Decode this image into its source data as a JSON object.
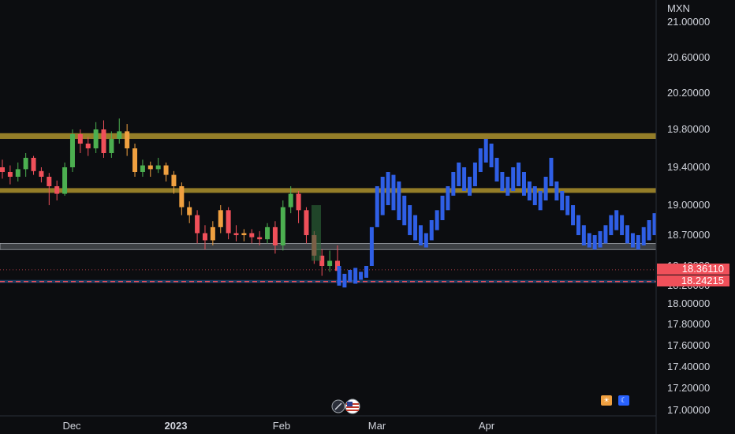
{
  "axis": {
    "currency": "MXN",
    "y_ticks": [
      "21.00000",
      "20.60000",
      "20.20000",
      "19.80000",
      "19.40000",
      "19.00000",
      "18.70000",
      "18.40000",
      "18.20000",
      "18.00000",
      "17.80000",
      "17.60000",
      "17.40000",
      "17.20000",
      "17.00000"
    ],
    "x_ticks": [
      "Dec",
      "2023",
      "Feb",
      "Mar",
      "Apr"
    ]
  },
  "price_tags": {
    "last_price": "18.36110",
    "dashed_level": "18.24215"
  },
  "colors": {
    "background": "#0c0d10",
    "up_candle": "#4caf50",
    "down_candle": "#f0505a",
    "orange_candle": "#f0a040",
    "blue_bars": "#2f5fe6",
    "resistance_zone": "#b69a2e",
    "support_zone": "#9aa0a6",
    "dashed_line": "#f0505a",
    "last_price_tag": "#f0505a"
  },
  "chart_data": {
    "type": "candlestick",
    "y_unit": "MXN",
    "ylim": [
      17.0,
      21.2
    ],
    "x_ticks": [
      "Dec",
      "2023",
      "Feb",
      "Mar",
      "Apr"
    ],
    "levels": [
      {
        "kind": "zone",
        "low": 19.7,
        "high": 19.76
      },
      {
        "kind": "zone",
        "low": 19.13,
        "high": 19.18
      },
      {
        "kind": "zone",
        "low": 18.56,
        "high": 18.62
      },
      {
        "kind": "dashed",
        "value": 18.24215
      },
      {
        "kind": "dotted",
        "value": 18.3611
      }
    ],
    "historical_candles": [
      [
        19.4,
        19.35,
        19.48,
        19.28
      ],
      [
        19.35,
        19.3,
        19.42,
        19.22
      ],
      [
        19.3,
        19.38,
        19.45,
        19.25
      ],
      [
        19.38,
        19.5,
        19.55,
        19.3
      ],
      [
        19.5,
        19.36,
        19.52,
        19.32
      ],
      [
        19.36,
        19.3,
        19.4,
        19.24
      ],
      [
        19.3,
        19.2,
        19.34,
        19.0
      ],
      [
        19.2,
        19.12,
        19.26,
        19.05
      ],
      [
        19.12,
        19.4,
        19.45,
        19.1
      ],
      [
        19.4,
        19.75,
        19.8,
        19.35
      ],
      [
        19.75,
        19.65,
        19.8,
        19.55
      ],
      [
        19.65,
        19.6,
        19.72,
        19.52
      ],
      [
        19.6,
        19.8,
        19.88,
        19.55
      ],
      [
        19.8,
        19.55,
        19.9,
        19.5
      ],
      [
        19.55,
        19.7,
        19.78,
        19.5
      ],
      [
        19.7,
        19.78,
        19.92,
        19.65
      ],
      [
        19.78,
        19.6,
        19.86,
        19.52
      ],
      [
        19.6,
        19.35,
        19.65,
        19.3
      ],
      [
        19.35,
        19.42,
        19.48,
        19.3
      ],
      [
        19.42,
        19.38,
        19.46,
        19.3
      ],
      [
        19.38,
        19.42,
        19.5,
        19.34
      ],
      [
        19.42,
        19.32,
        19.45,
        19.25
      ],
      [
        19.32,
        19.2,
        19.36,
        19.12
      ],
      [
        19.2,
        18.98,
        19.24,
        18.9
      ],
      [
        18.98,
        18.9,
        19.04,
        18.82
      ],
      [
        18.9,
        18.72,
        18.95,
        18.62
      ],
      [
        18.72,
        18.65,
        18.8,
        18.56
      ],
      [
        18.65,
        18.78,
        18.84,
        18.6
      ],
      [
        18.78,
        18.95,
        19.0,
        18.72
      ],
      [
        18.95,
        18.72,
        18.98,
        18.66
      ],
      [
        18.72,
        18.7,
        18.8,
        18.64
      ],
      [
        18.7,
        18.72,
        18.76,
        18.64
      ],
      [
        18.72,
        18.68,
        18.76,
        18.62
      ],
      [
        18.68,
        18.66,
        18.74,
        18.6
      ],
      [
        18.66,
        18.78,
        18.82,
        18.62
      ],
      [
        18.78,
        18.6,
        18.84,
        18.52
      ],
      [
        18.6,
        18.98,
        19.05,
        18.55
      ],
      [
        18.98,
        19.12,
        19.2,
        18.92
      ],
      [
        19.12,
        18.95,
        19.15,
        18.82
      ],
      [
        18.95,
        18.7,
        18.98,
        18.62
      ],
      [
        18.7,
        18.5,
        18.74,
        18.42
      ],
      [
        18.5,
        18.4,
        18.56,
        18.3
      ],
      [
        18.4,
        18.45,
        18.55,
        18.34
      ],
      [
        18.45,
        18.35,
        18.6,
        18.28
      ]
    ],
    "projected_bars": [
      [
        18.2,
        18.4
      ],
      [
        18.18,
        18.32
      ],
      [
        18.24,
        18.36
      ],
      [
        18.22,
        18.38
      ],
      [
        18.26,
        18.34
      ],
      [
        18.28,
        18.4
      ],
      [
        18.4,
        18.78
      ],
      [
        18.78,
        19.2
      ],
      [
        18.9,
        19.3
      ],
      [
        19.0,
        19.35
      ],
      [
        18.95,
        19.32
      ],
      [
        18.85,
        19.25
      ],
      [
        18.8,
        19.1
      ],
      [
        18.7,
        19.0
      ],
      [
        18.65,
        18.9
      ],
      [
        18.6,
        18.8
      ],
      [
        18.58,
        18.72
      ],
      [
        18.65,
        18.85
      ],
      [
        18.75,
        18.95
      ],
      [
        18.85,
        19.1
      ],
      [
        18.95,
        19.2
      ],
      [
        19.1,
        19.35
      ],
      [
        19.2,
        19.45
      ],
      [
        19.15,
        19.4
      ],
      [
        19.1,
        19.3
      ],
      [
        19.2,
        19.45
      ],
      [
        19.35,
        19.6
      ],
      [
        19.45,
        19.7
      ],
      [
        19.4,
        19.65
      ],
      [
        19.25,
        19.5
      ],
      [
        19.15,
        19.35
      ],
      [
        19.1,
        19.3
      ],
      [
        19.15,
        19.4
      ],
      [
        19.2,
        19.45
      ],
      [
        19.1,
        19.35
      ],
      [
        19.05,
        19.25
      ],
      [
        19.0,
        19.2
      ],
      [
        18.95,
        19.15
      ],
      [
        19.05,
        19.3
      ],
      [
        19.2,
        19.5
      ],
      [
        19.05,
        19.25
      ],
      [
        18.95,
        19.15
      ],
      [
        18.9,
        19.1
      ],
      [
        18.8,
        19.0
      ],
      [
        18.7,
        18.9
      ],
      [
        18.6,
        18.8
      ],
      [
        18.58,
        18.72
      ],
      [
        18.56,
        18.7
      ],
      [
        18.58,
        18.74
      ],
      [
        18.62,
        18.8
      ],
      [
        18.7,
        18.9
      ],
      [
        18.75,
        18.95
      ],
      [
        18.7,
        18.9
      ],
      [
        18.62,
        18.8
      ],
      [
        18.58,
        18.72
      ],
      [
        18.56,
        18.7
      ],
      [
        18.6,
        18.78
      ],
      [
        18.65,
        18.85
      ],
      [
        18.7,
        18.92
      ]
    ]
  }
}
